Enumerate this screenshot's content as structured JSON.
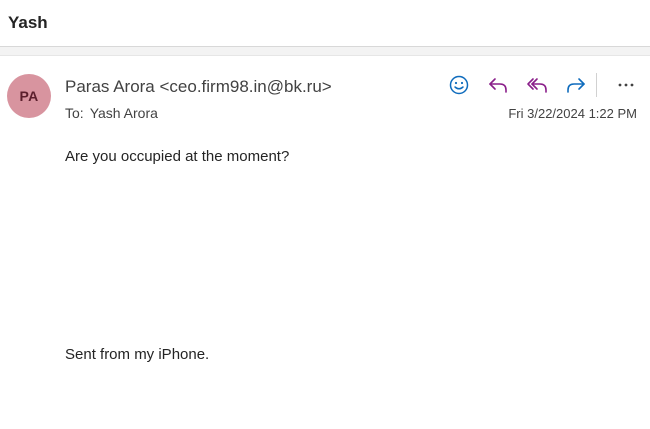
{
  "email": {
    "subject": "Yash",
    "sender": {
      "initials": "PA",
      "display": "Paras Arora <ceo.firm98.in@bk.ru>",
      "avatar_bg": "#d8949f",
      "avatar_fg": "#5b1f2c"
    },
    "to_label": "To:",
    "to": "Yash Arora",
    "date": "Fri 3/22/2024 1:22 PM",
    "body": [
      "Are you occupied at the moment?",
      "Sent from my iPhone."
    ]
  },
  "actions": [
    {
      "name": "emoji-reaction-icon",
      "color": "#0f6cbd"
    },
    {
      "name": "reply-icon",
      "color": "#8a1f8a"
    },
    {
      "name": "reply-all-icon",
      "color": "#8a1f8a"
    },
    {
      "name": "forward-icon",
      "color": "#0f6cbd"
    },
    {
      "name": "more-options-icon",
      "color": "#424242"
    }
  ]
}
